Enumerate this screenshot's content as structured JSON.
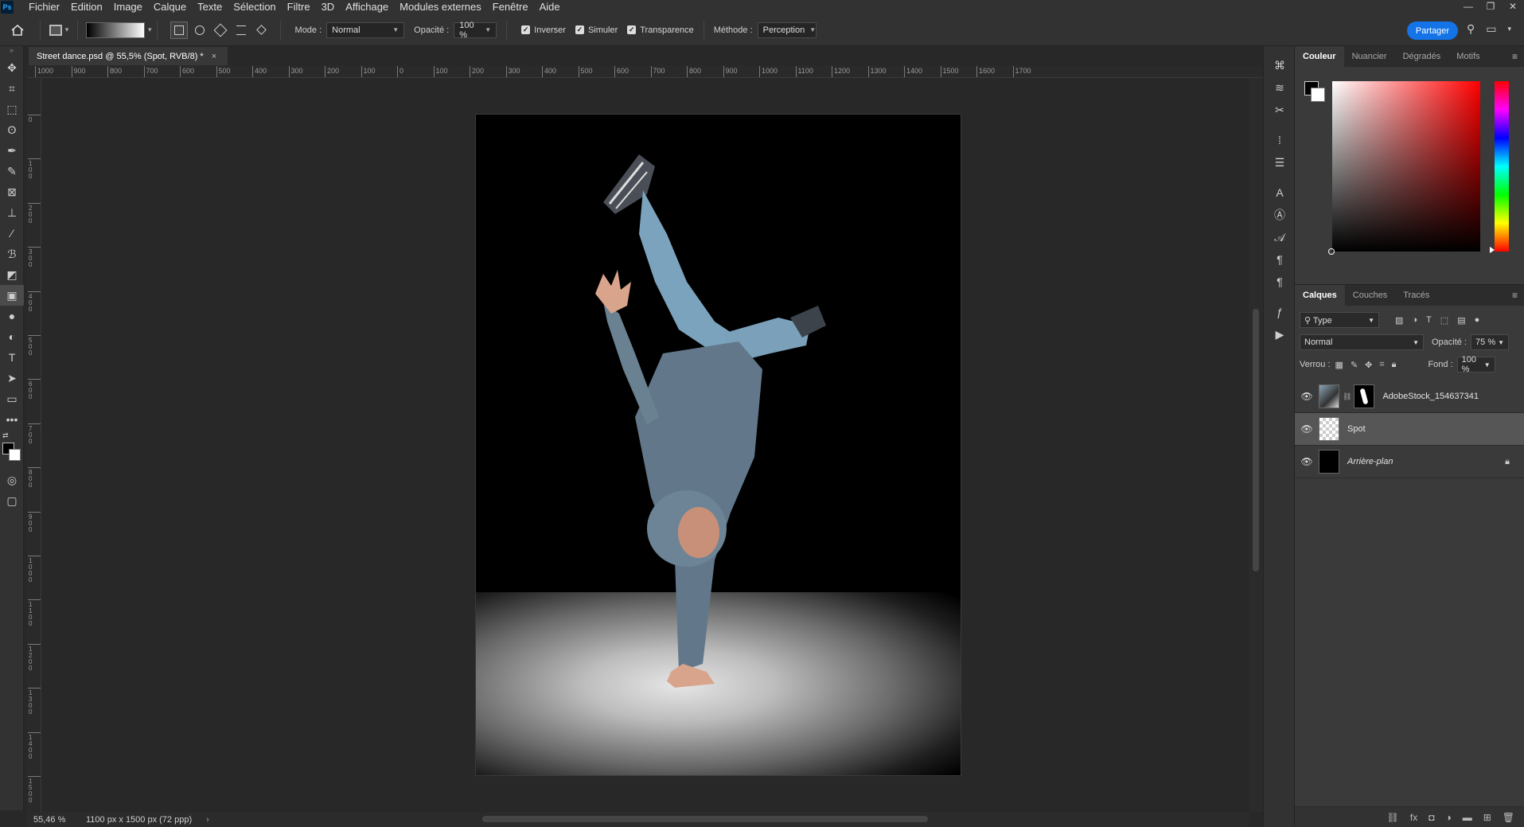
{
  "app": {
    "logo": "Ps"
  },
  "menu": [
    "Fichier",
    "Edition",
    "Image",
    "Calque",
    "Texte",
    "Sélection",
    "Filtre",
    "3D",
    "Affichage",
    "Modules externes",
    "Fenêtre",
    "Aide"
  ],
  "window_controls": {
    "minimize": "—",
    "restore": "❐",
    "close": "✕"
  },
  "options": {
    "mode_label": "Mode :",
    "mode_value": "Normal",
    "opacity_label": "Opacité :",
    "opacity_value": "100 %",
    "inverse_label": "Inverser",
    "dither_label": "Simuler",
    "transparency_label": "Transparence",
    "method_label": "Méthode :",
    "method_value": "Perception",
    "share_label": "Partager"
  },
  "document": {
    "tab_title": "Street dance.psd @ 55,5% (Spot, RVB/8) *",
    "close": "×"
  },
  "ruler_top_labels": [
    "1000",
    "900",
    "800",
    "700",
    "600",
    "500",
    "400",
    "300",
    "200",
    "100",
    "0",
    "100",
    "200",
    "300",
    "400",
    "500",
    "600",
    "700",
    "800",
    "900",
    "1000",
    "1100",
    "1200",
    "1300",
    "1400",
    "1500",
    "1600",
    "1700"
  ],
  "ruler_left_labels": [
    "0",
    "100",
    "200",
    "300",
    "400",
    "500",
    "600",
    "700",
    "800",
    "900",
    "1000",
    "1100",
    "1200",
    "1300",
    "1400",
    "1500"
  ],
  "status": {
    "zoom": "55,46 %",
    "dimensions": "1100 px x 1500 px (72 ppp)",
    "arrow": "›"
  },
  "color_panel": {
    "tabs": [
      "Couleur",
      "Nuancier",
      "Dégradés",
      "Motifs"
    ],
    "active_tab": "Couleur"
  },
  "layers_panel": {
    "tabs": [
      "Calques",
      "Couches",
      "Tracés"
    ],
    "filter_value": "Type",
    "blend_mode": "Normal",
    "opacity_label": "Opacité :",
    "opacity_value": "75 %",
    "lock_label": "Verrou :",
    "fill_label": "Fond :",
    "fill_value": "100 %",
    "layers": [
      {
        "name": "AdobeStock_154637341",
        "visible": true,
        "selected": false
      },
      {
        "name": "Spot",
        "visible": true,
        "selected": true
      },
      {
        "name": "Arrière-plan",
        "visible": true,
        "selected": false,
        "locked": true
      }
    ]
  }
}
